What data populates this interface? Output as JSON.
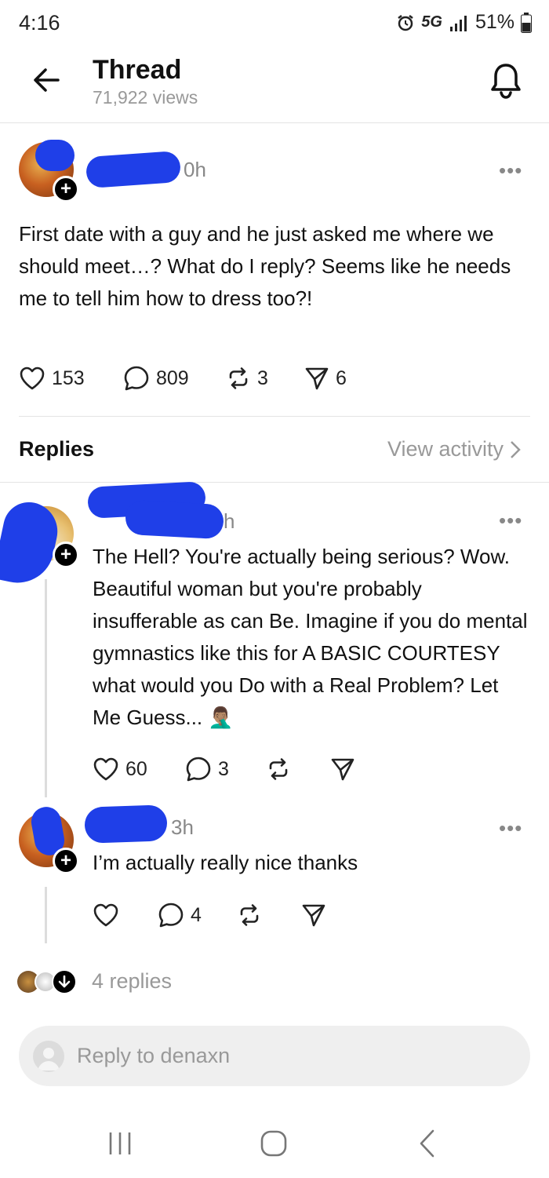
{
  "status_bar": {
    "time": "4:16",
    "network": "5G",
    "battery": "51%"
  },
  "header": {
    "title": "Thread",
    "views": "71,922 views"
  },
  "post": {
    "time": "0h",
    "more": "•••",
    "text": "First date with a guy and he just asked me where we should meet…? What do I reply? Seems like he needs me to tell him how to dress too?!",
    "likes": "153",
    "comments": "809",
    "reposts": "3",
    "shares": "6"
  },
  "replies_header": {
    "label": "Replies",
    "view_activity": "View activity"
  },
  "reply1": {
    "time": "h",
    "more": "•••",
    "text": "The Hell? You're actually being serious? Wow. Beautiful woman but you're probably insufferable as can Be. Imagine if you do mental gymnastics like this for A BASIC COURTESY what would you Do with a Real Problem? Let Me Guess... 🤦🏽‍♂️",
    "likes": "60",
    "comments": "3"
  },
  "reply2": {
    "time": "3h",
    "more": "•••",
    "text": "I’m actually really nice thanks",
    "comments": "4"
  },
  "more_replies": {
    "label": "4 replies"
  },
  "reply_input": {
    "placeholder": "Reply to denaxn"
  },
  "icons": [
    "back-arrow-icon",
    "bell-icon",
    "heart-icon",
    "comment-icon",
    "repost-icon",
    "send-icon",
    "plus-icon",
    "chevron-right-icon",
    "down-arrow-icon"
  ],
  "colors": {
    "redaction": "#1f3fe8",
    "muted": "#999999",
    "divider": "#e4e4e4"
  }
}
